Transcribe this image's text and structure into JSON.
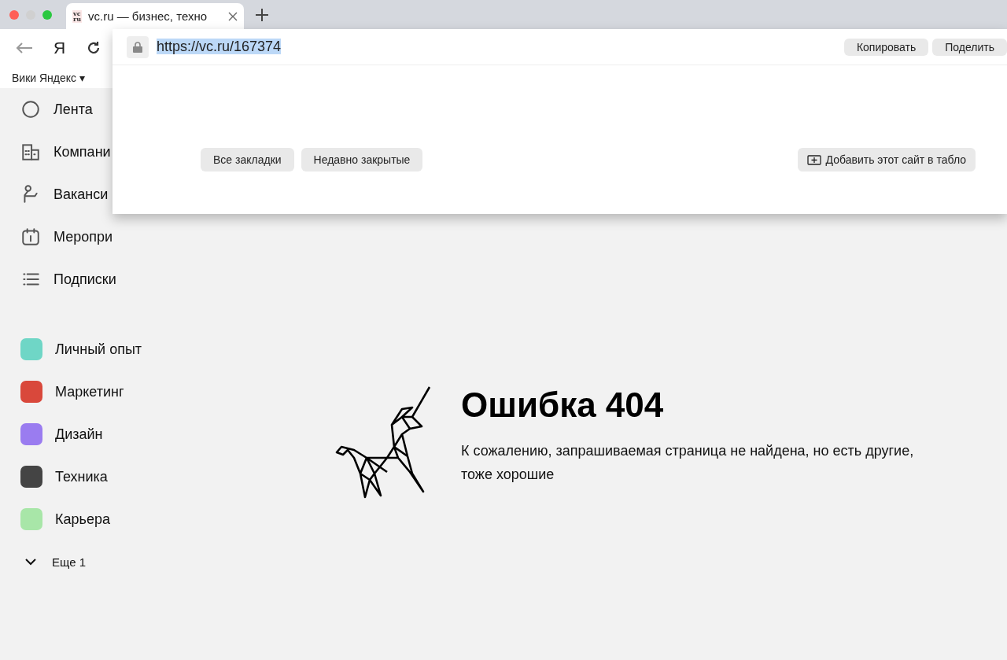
{
  "browser": {
    "tab": {
      "title": "vc.ru — бизнес, техно",
      "favicon": "vc\nru",
      "selected": true
    },
    "nav": {
      "yandex": "Я"
    },
    "bookmarks": [
      {
        "label": "Вики Яндекс",
        "caret": "▾"
      }
    ]
  },
  "omnibox": {
    "url": "https://vc.ru/167374",
    "url_selected": true,
    "actions": [
      "Копировать",
      "Поделить"
    ],
    "shortcuts": [
      "Все закладки",
      "Недавно закрытые"
    ],
    "add_button": "Добавить этот сайт в табло"
  },
  "sidebar": {
    "items": [
      {
        "label": "Лента"
      },
      {
        "label": "Компани"
      },
      {
        "label": "Ваканси"
      },
      {
        "label": "Меропри"
      },
      {
        "label": "Подписки"
      }
    ],
    "subsites": [
      {
        "label": "Личный опыт",
        "color": "#6fd6c6"
      },
      {
        "label": "Маркетинг",
        "color": "#d9483b"
      },
      {
        "label": "Дизайн",
        "color": "#9a7cf0"
      },
      {
        "label": "Техника",
        "color": "#444444"
      },
      {
        "label": "Карьера",
        "color": "#a8e6a8"
      }
    ],
    "more": "Еще 1"
  },
  "error": {
    "title": "Ошибка 404",
    "text": "К сожалению, запрашиваемая страница не найдена, но есть другие, тоже хорошие"
  }
}
